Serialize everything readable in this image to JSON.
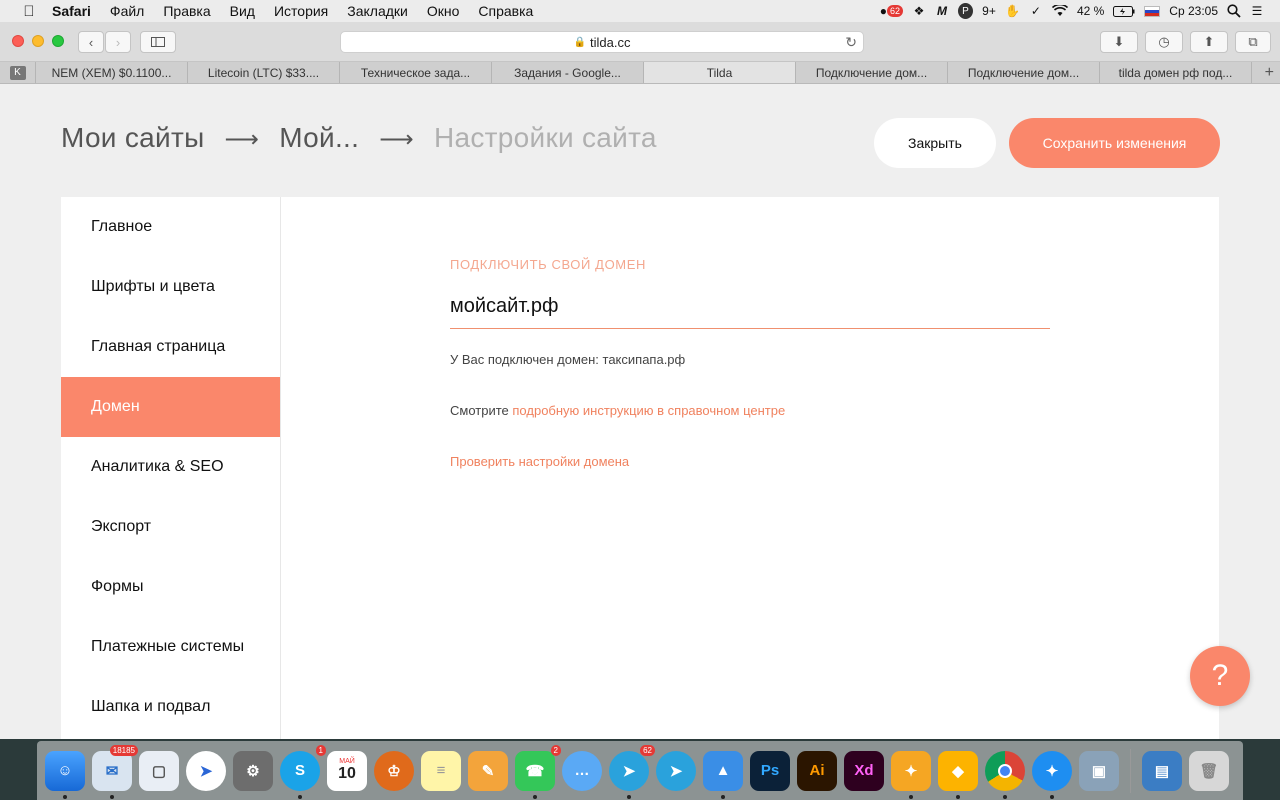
{
  "menubar": {
    "app_name": "Safari",
    "items": [
      "Файл",
      "Правка",
      "Вид",
      "История",
      "Закладки",
      "Окно",
      "Справка"
    ],
    "status": {
      "badge_count": "62",
      "notifications": "9+",
      "battery": "42 %",
      "clock": "Ср 23:05"
    }
  },
  "browser": {
    "url": "tilda.cc",
    "tabs": [
      {
        "label": "NEM (XEM) $0.1100..."
      },
      {
        "label": "Litecoin (LTC) $33...."
      },
      {
        "label": "Техническое зада..."
      },
      {
        "label": "Задания - Google..."
      },
      {
        "label": "Tilda"
      },
      {
        "label": "Подключение дом..."
      },
      {
        "label": "Подключение дом..."
      },
      {
        "label": "tilda домен рф под..."
      }
    ],
    "pinned_tab": "K"
  },
  "header": {
    "breadcrumb": [
      "Мои сайты",
      "Мой...",
      "Настройки сайта"
    ],
    "close_label": "Закрыть",
    "save_label": "Сохранить изменения"
  },
  "sidebar": {
    "items": [
      {
        "label": "Главное"
      },
      {
        "label": "Шрифты и цвета"
      },
      {
        "label": "Главная страница"
      },
      {
        "label": "Домен"
      },
      {
        "label": "Аналитика & SEO"
      },
      {
        "label": "Экспорт"
      },
      {
        "label": "Формы"
      },
      {
        "label": "Платежные системы"
      },
      {
        "label": "Шапка и подвал"
      }
    ],
    "active": "Домен"
  },
  "domain": {
    "label": "ПОДКЛЮЧИТЬ СВОЙ ДОМЕН",
    "value": "мойсайт.рф",
    "connected_text": "У Вас подключен домен: таксипапа.рф",
    "instruction_prefix": "Смотрите",
    "instruction_link": "подробную инструкцию в справочном центре",
    "check_link": "Проверить настройки домена"
  },
  "help": {
    "label": "?"
  },
  "dock": {
    "mail_badge": "18185",
    "skype_badge": "1",
    "calendar_month": "МАЙ",
    "calendar_day": "10",
    "facetime_badge": "2",
    "telegram_badge": "62",
    "ps_label": "Ps",
    "ai_label": "Ai",
    "xd_label": "Xd"
  },
  "colors": {
    "accent": "#fa876b",
    "link": "#f0825f",
    "label": "#f4a78f"
  }
}
